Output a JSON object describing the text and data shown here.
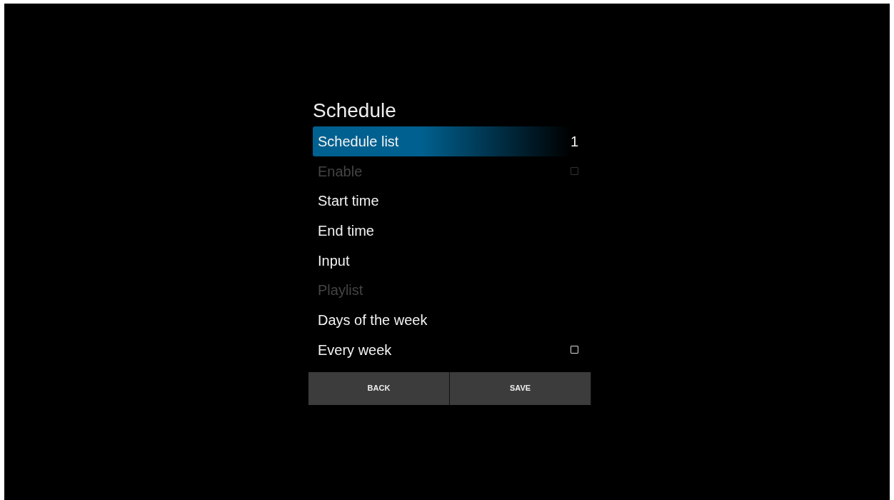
{
  "title": "Schedule",
  "items": [
    {
      "label": "Schedule list",
      "kind": "value",
      "value": "1",
      "selected": true,
      "disabled": false
    },
    {
      "label": "Enable",
      "kind": "checkbox",
      "checked": false,
      "selected": false,
      "disabled": true
    },
    {
      "label": "Start time",
      "kind": "plain",
      "selected": false,
      "disabled": false
    },
    {
      "label": "End time",
      "kind": "plain",
      "selected": false,
      "disabled": false
    },
    {
      "label": "Input",
      "kind": "plain",
      "selected": false,
      "disabled": false
    },
    {
      "label": "Playlist",
      "kind": "plain",
      "selected": false,
      "disabled": true
    },
    {
      "label": "Days of the week",
      "kind": "plain",
      "selected": false,
      "disabled": false
    },
    {
      "label": "Every week",
      "kind": "checkbox",
      "checked": false,
      "selected": false,
      "disabled": false
    }
  ],
  "buttons": [
    "BACK",
    "SAVE"
  ]
}
